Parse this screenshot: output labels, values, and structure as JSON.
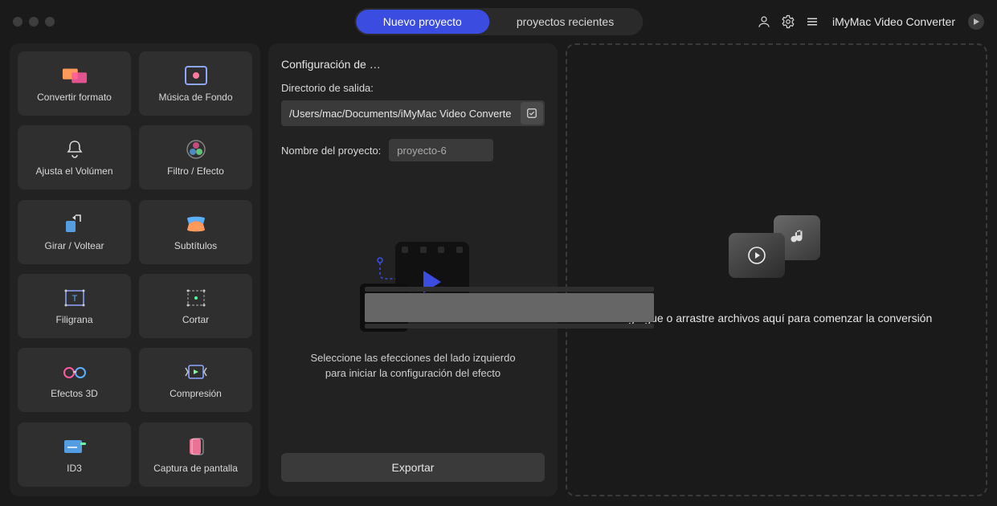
{
  "tabs": {
    "new": "Nuevo proyecto",
    "recent": "proyectos recientes"
  },
  "app_name": "iMyMac Video Converter",
  "sidebar": {
    "items": [
      {
        "label": "Convertir formato"
      },
      {
        "label": "Música de Fondo"
      },
      {
        "label": "Ajusta el Volúmen"
      },
      {
        "label": "Filtro / Efecto"
      },
      {
        "label": "Girar / Voltear"
      },
      {
        "label": "Subtítulos"
      },
      {
        "label": "Filigrana"
      },
      {
        "label": "Cortar"
      },
      {
        "label": "Efectos 3D"
      },
      {
        "label": "Compresión"
      },
      {
        "label": "ID3"
      },
      {
        "label": "Captura de pantalla"
      }
    ]
  },
  "mid": {
    "title": "Configuración de …",
    "out_dir_label": "Directorio de salida:",
    "out_dir": "/Users/mac/Documents/iMyMac Video Converte",
    "proj_name_label": "Nombre del proyecto:",
    "proj_name": "proyecto-6",
    "hint": "Seleccione las efecciones del lado izquierdo para iniciar la configuración del efecto",
    "export": "Exportar"
  },
  "drop": {
    "hint": "Agregue o arrastre archivos aquí para comenzar la conversión"
  }
}
